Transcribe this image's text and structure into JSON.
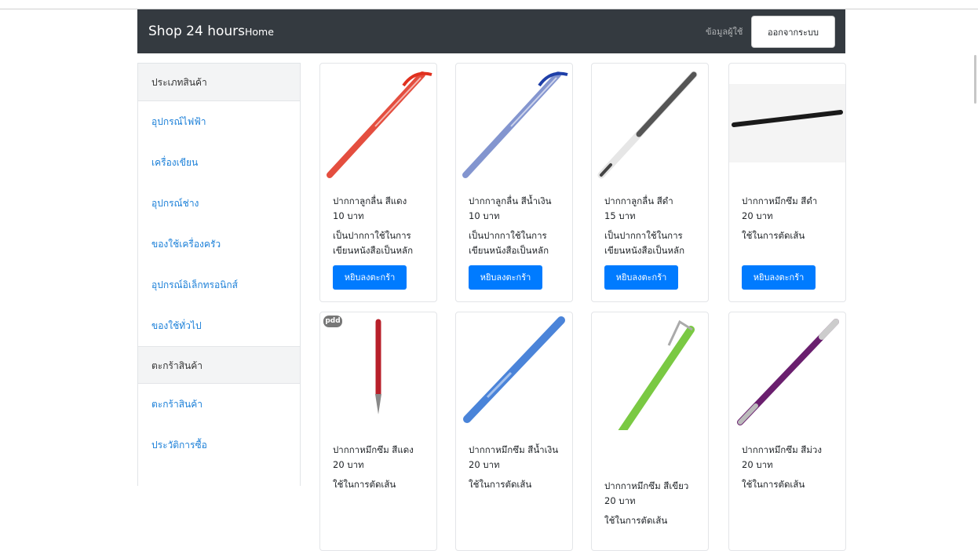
{
  "navbar": {
    "brand": "Shop 24 hours",
    "home": "Home",
    "user_info": "ข้อมูลผู้ใช้",
    "logout": "ออกจากระบบ"
  },
  "sidebar": {
    "category_header": "ประเภทสินค้า",
    "categories": [
      "อุปกรณ์ไฟฟ้า",
      "เครื่องเขียน",
      "อุปกรณ์ช่าง",
      "ของใช้เครื่องครัว",
      "อุปกรณ์อิเล็กทรอนิกส์",
      "ของใช้ทั่วไป"
    ],
    "cart_header": "ตะกร้าสินค้า",
    "cart_links": [
      "ตะกร้าสินค้า",
      "ประวัติการซื้อ"
    ]
  },
  "buy_label": "หยิบลงตะกร้า",
  "products": [
    {
      "name": "ปากกาลูกลื่น สีแดง",
      "price": "10 บาท",
      "desc": "เป็นปากกาใช้ในการเขียนหนังสือเป็นหลัก",
      "color": "#e0301e"
    },
    {
      "name": "ปากกาลูกลื่น สีน้ำเงิน",
      "price": "10 บาท",
      "desc": "เป็นปากกาใช้ในการเขียนหนังสือเป็นหลัก",
      "color": "#1f3fa8"
    },
    {
      "name": "ปากกาลูกลื่น สีดำ",
      "price": "15 บาท",
      "desc": "เป็นปากกาใช้ในการเขียนหนังสือเป็นหลัก",
      "color": "#555555"
    },
    {
      "name": "ปากกาหมึกซึม สีดำ",
      "price": "20 บาท",
      "desc": "ใช้ในการตัดเส้น",
      "color": "#1a1a1a"
    },
    {
      "name": "ปากกาหมึกซึม สีแดง",
      "price": "20 บาท",
      "desc": "ใช้ในการตัดเส้น",
      "color": "#b8202a"
    },
    {
      "name": "ปากกาหมึกซึม สีน้ำเงิน",
      "price": "20 บาท",
      "desc": "ใช้ในการตัดเส้น",
      "color": "#1e66d0"
    },
    {
      "name": "ปากกาหมึกซึม สีเขียว",
      "price": "20 บาท",
      "desc": "ใช้ในการตัดเส้น",
      "color": "#7ac943"
    },
    {
      "name": "ปากกาหมึกซึม สีม่วง",
      "price": "20 บาท",
      "desc": "ใช้ในการตัดเส้น",
      "color": "#6a1f6e"
    }
  ],
  "badge": "pdd"
}
